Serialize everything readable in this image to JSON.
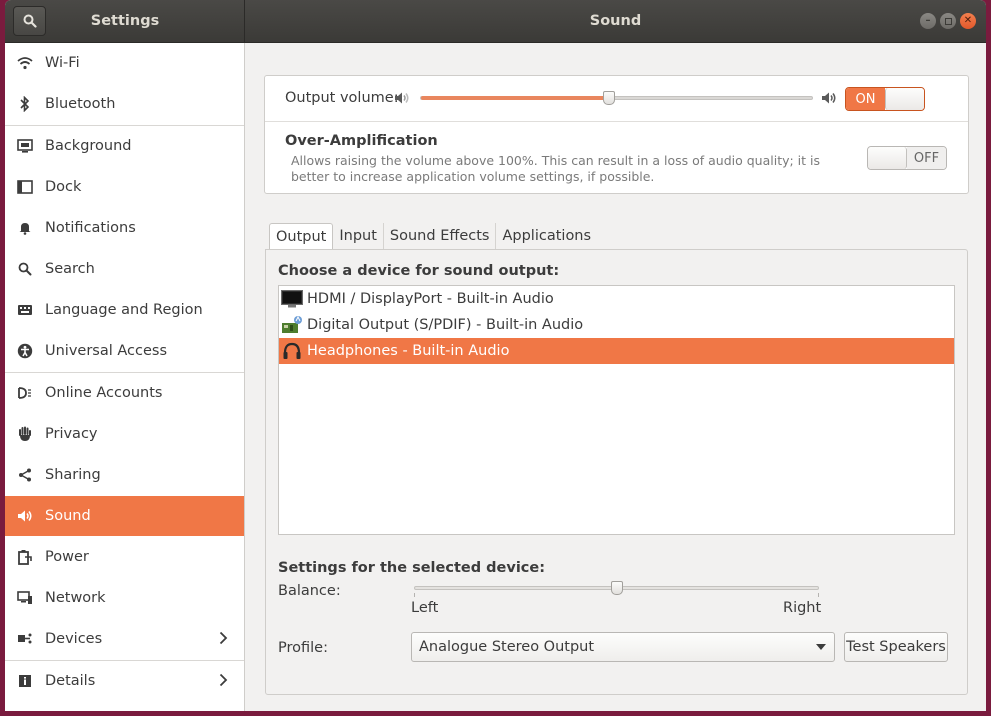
{
  "window": {
    "sidebar_title": "Settings",
    "panel_title": "Sound",
    "buttons": [
      "minimize",
      "maximize",
      "close"
    ]
  },
  "sidebar": {
    "items": [
      {
        "label": "Wi-Fi",
        "icon": "wifi-icon"
      },
      {
        "label": "Bluetooth",
        "icon": "bluetooth-icon"
      },
      {
        "label": "Background",
        "icon": "background-icon"
      },
      {
        "label": "Dock",
        "icon": "dock-icon"
      },
      {
        "label": "Notifications",
        "icon": "bell-icon"
      },
      {
        "label": "Search",
        "icon": "search-icon"
      },
      {
        "label": "Language and Region",
        "icon": "keyboard-icon"
      },
      {
        "label": "Universal Access",
        "icon": "accessibility-icon"
      },
      {
        "label": "Online Accounts",
        "icon": "online-accounts-icon"
      },
      {
        "label": "Privacy",
        "icon": "hand-icon"
      },
      {
        "label": "Sharing",
        "icon": "share-icon"
      },
      {
        "label": "Sound",
        "icon": "speaker-icon",
        "active": true
      },
      {
        "label": "Power",
        "icon": "power-icon"
      },
      {
        "label": "Network",
        "icon": "network-icon"
      },
      {
        "label": "Devices",
        "icon": "devices-icon",
        "has_submenu": true
      },
      {
        "label": "Details",
        "icon": "info-icon",
        "has_submenu": true
      }
    ]
  },
  "volume": {
    "output_label": "Output volume:",
    "level_fraction": 0.48,
    "switch_label": "ON",
    "switch_state": "on"
  },
  "amplification": {
    "title": "Over-Amplification",
    "description": "Allows raising the volume above 100%. This can result in a loss of audio quality; it is better to increase application volume settings, if possible.",
    "switch_label": "OFF",
    "switch_state": "off"
  },
  "tabs": [
    {
      "label": "Output",
      "active": true
    },
    {
      "label": "Input"
    },
    {
      "label": "Sound Effects"
    },
    {
      "label": "Applications"
    }
  ],
  "output": {
    "choose_label": "Choose a device for sound output:",
    "devices": [
      {
        "label": "HDMI / DisplayPort - Built-in Audio",
        "icon": "monitor-icon"
      },
      {
        "label": "Digital Output (S/PDIF) - Built-in Audio",
        "icon": "soundcard-icon"
      },
      {
        "label": "Headphones - Built-in Audio",
        "icon": "headphones-icon",
        "selected": true
      }
    ],
    "settings_label": "Settings for the selected device:",
    "balance_label": "Balance:",
    "balance_left": "Left",
    "balance_right": "Right",
    "balance_fraction": 0.5,
    "profile_label": "Profile:",
    "profile_value": "Analogue Stereo Output",
    "test_button": "Test Speakers"
  },
  "colors": {
    "accent": "#f07746",
    "headerbar": "#3e3d39"
  }
}
